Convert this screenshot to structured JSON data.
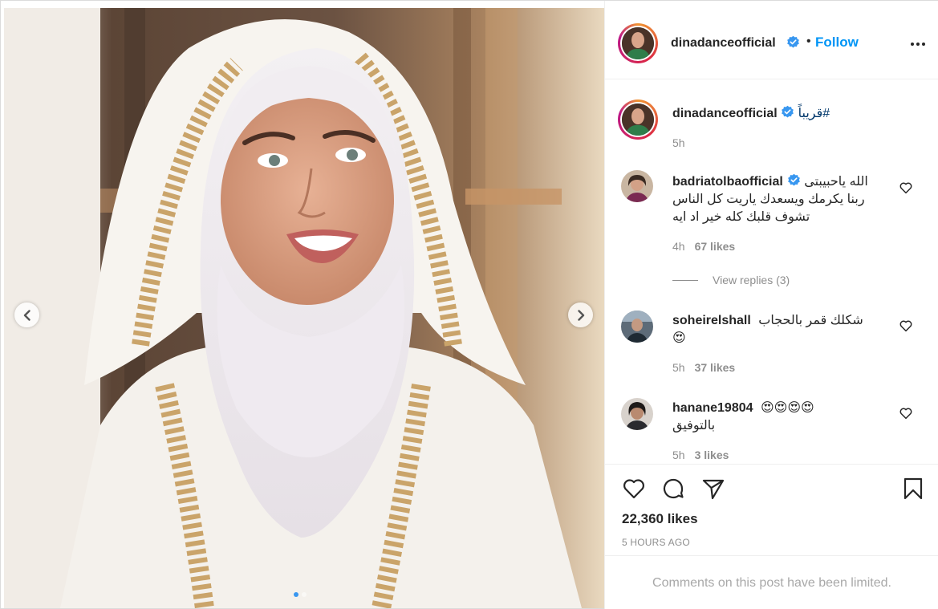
{
  "header": {
    "username": "dinadanceofficial",
    "separator": "•",
    "follow_label": "Follow"
  },
  "carousel": {
    "slide_count": 2,
    "active_index": 0
  },
  "caption": {
    "username": "dinadanceofficial",
    "text": "قريباً#",
    "time": "5h"
  },
  "comments": [
    {
      "username": "badriatolbaofficial",
      "verified": true,
      "lines": [
        "الله ياحبيبتى",
        "ربنا يكرمك ويسعدك ياريت كل الناس",
        "تشوف قلبك كله خير اد ايه"
      ],
      "time": "4h",
      "likes": "67 likes",
      "view_replies": "View replies (3)"
    },
    {
      "username": "soheirelshall",
      "verified": false,
      "lines": [
        "شكلك قمر بالحجاب",
        "😍"
      ],
      "time": "5h",
      "likes": "37 likes"
    },
    {
      "username": "hanane19804",
      "verified": false,
      "lines": [
        "😍😍😍😍",
        "بالتوفيق"
      ],
      "time": "5h",
      "likes": "3 likes"
    }
  ],
  "actions": {
    "likes": "22,360 likes",
    "posted": "5 HOURS AGO"
  },
  "comments_limited": "Comments on this post have been limited.",
  "colors": {
    "accent": "#0095f6",
    "verified": "#3897f0",
    "muted": "#8e8e8e",
    "text": "#262626"
  },
  "icons": [
    "chevron-left-icon",
    "chevron-right-icon",
    "verified-badge-icon",
    "more-options-icon",
    "heart-icon",
    "comment-icon",
    "share-icon",
    "bookmark-icon"
  ]
}
